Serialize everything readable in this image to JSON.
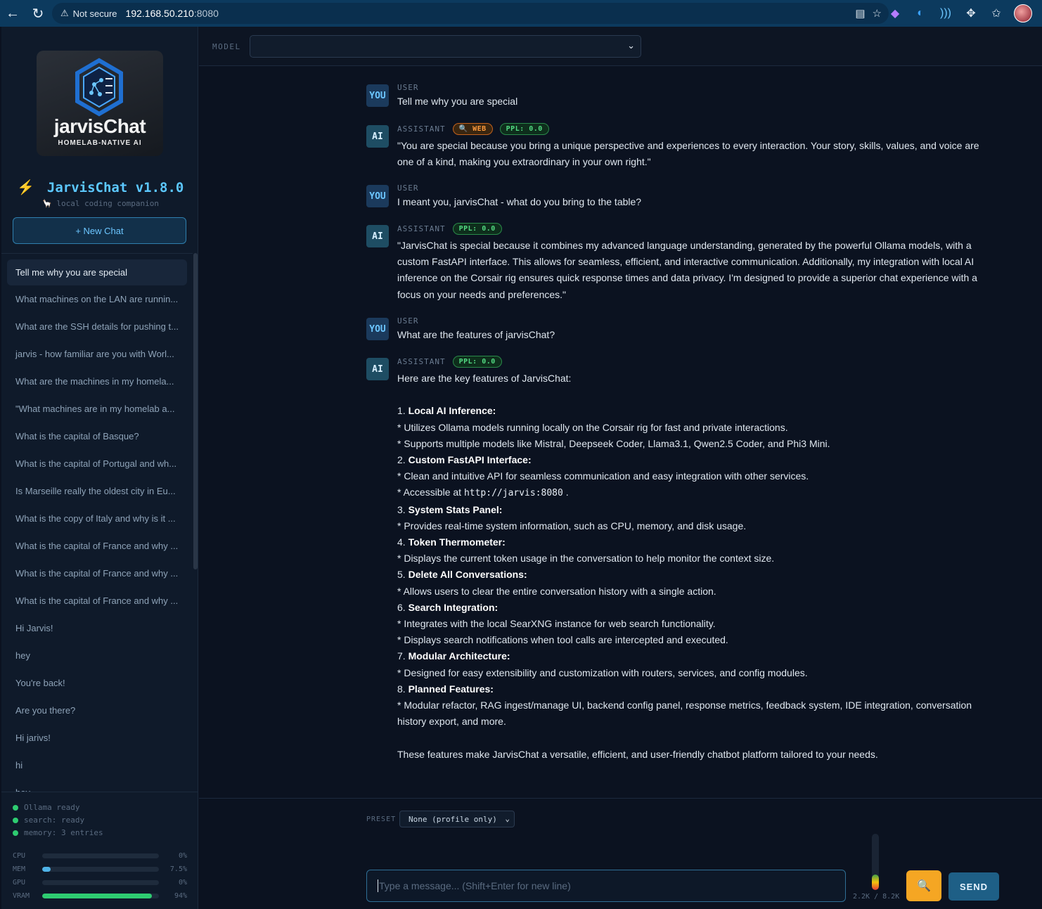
{
  "browser": {
    "security": "Not secure",
    "url_host": "192.168.50.210",
    "url_port": ":8080"
  },
  "sidebar": {
    "logo": {
      "brand": "jarvisChat",
      "sub": "HOMELAB-NATIVE AI"
    },
    "title": "JarvisChat v1.8.0",
    "subtitle": "local coding companion",
    "new_chat_label": "+ New Chat",
    "chats": [
      "Tell me why you are special",
      "What machines on the LAN are runnin...",
      "What are the SSH details for pushing t...",
      "jarvis - how familiar are you with Worl...",
      "What are the machines in my homela...",
      "\"What machines are in my homelab a...",
      "What is the capital of Basque?",
      "What is the capital of Portugal and wh...",
      "Is Marseille really the oldest city in Eu...",
      "What is the copy of Italy and why is it ...",
      "What is the capital of France and why ...",
      "What is the capital of France and why ...",
      "What is the capital of France and why ...",
      "Hi Jarvis!",
      "hey",
      "You're back!",
      "Are you there?",
      "Hi jarivs!",
      "hi",
      "hey"
    ],
    "status": [
      "Ollama ready",
      "search: ready",
      "memory: 3 entries"
    ],
    "stats": [
      {
        "label": "CPU",
        "value": "0%",
        "level": 0,
        "color": "#3aa0ff"
      },
      {
        "label": "MEM",
        "value": "7.5%",
        "level": 7.5,
        "color": "#4fb3e8"
      },
      {
        "label": "GPU",
        "value": "0%",
        "level": 0,
        "color": "#3aa0ff"
      },
      {
        "label": "VRAM",
        "value": "94%",
        "level": 94,
        "color": "#2ecc71"
      }
    ]
  },
  "main": {
    "model_label": "MODEL",
    "model_value": "",
    "messages": {
      "m1_role": "USER",
      "m1_badge": "YOU",
      "m1_text": "Tell me why you are special",
      "m2_role": "ASSISTANT",
      "m2_badge": "AI",
      "m2_web": "🔍 WEB",
      "m2_ppl": "PPL: 0.0",
      "m2_text": "\"You are special because you bring a unique perspective and experiences to every interaction. Your story, skills, values, and voice are one of a kind, making you extraordinary in your own right.\"",
      "m3_role": "USER",
      "m3_badge": "YOU",
      "m3_text": "I meant you, jarvisChat - what do you bring to the table?",
      "m4_role": "ASSISTANT",
      "m4_badge": "AI",
      "m4_ppl": "PPL: 0.0",
      "m4_text": "\"JarvisChat is special because it combines my advanced language understanding, generated by the powerful Ollama models, with a custom FastAPI interface. This allows for seamless, efficient, and interactive communication. Additionally, my integration with local AI inference on the Corsair rig ensures quick response times and data privacy. I'm designed to provide a superior chat experience with a focus on your needs and preferences.\"",
      "m5_role": "USER",
      "m5_badge": "YOU",
      "m5_text": "What are the features of jarvisChat?",
      "m6_role": "ASSISTANT",
      "m6_badge": "AI",
      "m6_ppl": "PPL: 0.0",
      "m6_intro": "Here are the key features of JarvisChat:",
      "f1_num": "1.",
      "f1_title": "Local AI Inference:",
      "f1_a": "* Utilizes Ollama models running locally on the Corsair rig for fast and private interactions.",
      "f1_b": "* Supports multiple models like Mistral, Deepseek Coder, Llama3.1, Qwen2.5 Coder, and Phi3 Mini.",
      "f2_num": "2.",
      "f2_title": "Custom FastAPI Interface:",
      "f2_a": "* Clean and intuitive API for seamless communication and easy integration with other services.",
      "f2_b_pre": "* Accessible at",
      "f2_b_code": "http://jarvis:8080",
      "f2_b_post": ".",
      "f3_num": "3.",
      "f3_title": "System Stats Panel:",
      "f3_a": "* Provides real-time system information, such as CPU, memory, and disk usage.",
      "f4_num": "4.",
      "f4_title": "Token Thermometer:",
      "f4_a": "* Displays the current token usage in the conversation to help monitor the context size.",
      "f5_num": "5.",
      "f5_title": "Delete All Conversations:",
      "f5_a": "* Allows users to clear the entire conversation history with a single action.",
      "f6_num": "6.",
      "f6_title": "Search Integration:",
      "f6_a": "* Integrates with the local SearXNG instance for web search functionality.",
      "f6_b": "* Displays search notifications when tool calls are intercepted and executed.",
      "f7_num": "7.",
      "f7_title": "Modular Architecture:",
      "f7_a": "* Designed for easy extensibility and customization with routers, services, and config modules.",
      "f8_num": "8.",
      "f8_title": "Planned Features:",
      "f8_a": "* Modular refactor, RAG ingest/manage UI, backend config panel, response metrics, feedback system, IDE integration, conversation history export, and more.",
      "m6_outro": "These features make JarvisChat a versatile, efficient, and user-friendly chatbot platform tailored to your needs."
    },
    "composer": {
      "preset_label": "PRESET",
      "preset_value": "None (profile only)",
      "placeholder": "Type a message... (Shift+Enter for new line)",
      "token_usage": "2.2K / 8.2K",
      "token_level": 0.27,
      "send_label": "SEND"
    }
  }
}
